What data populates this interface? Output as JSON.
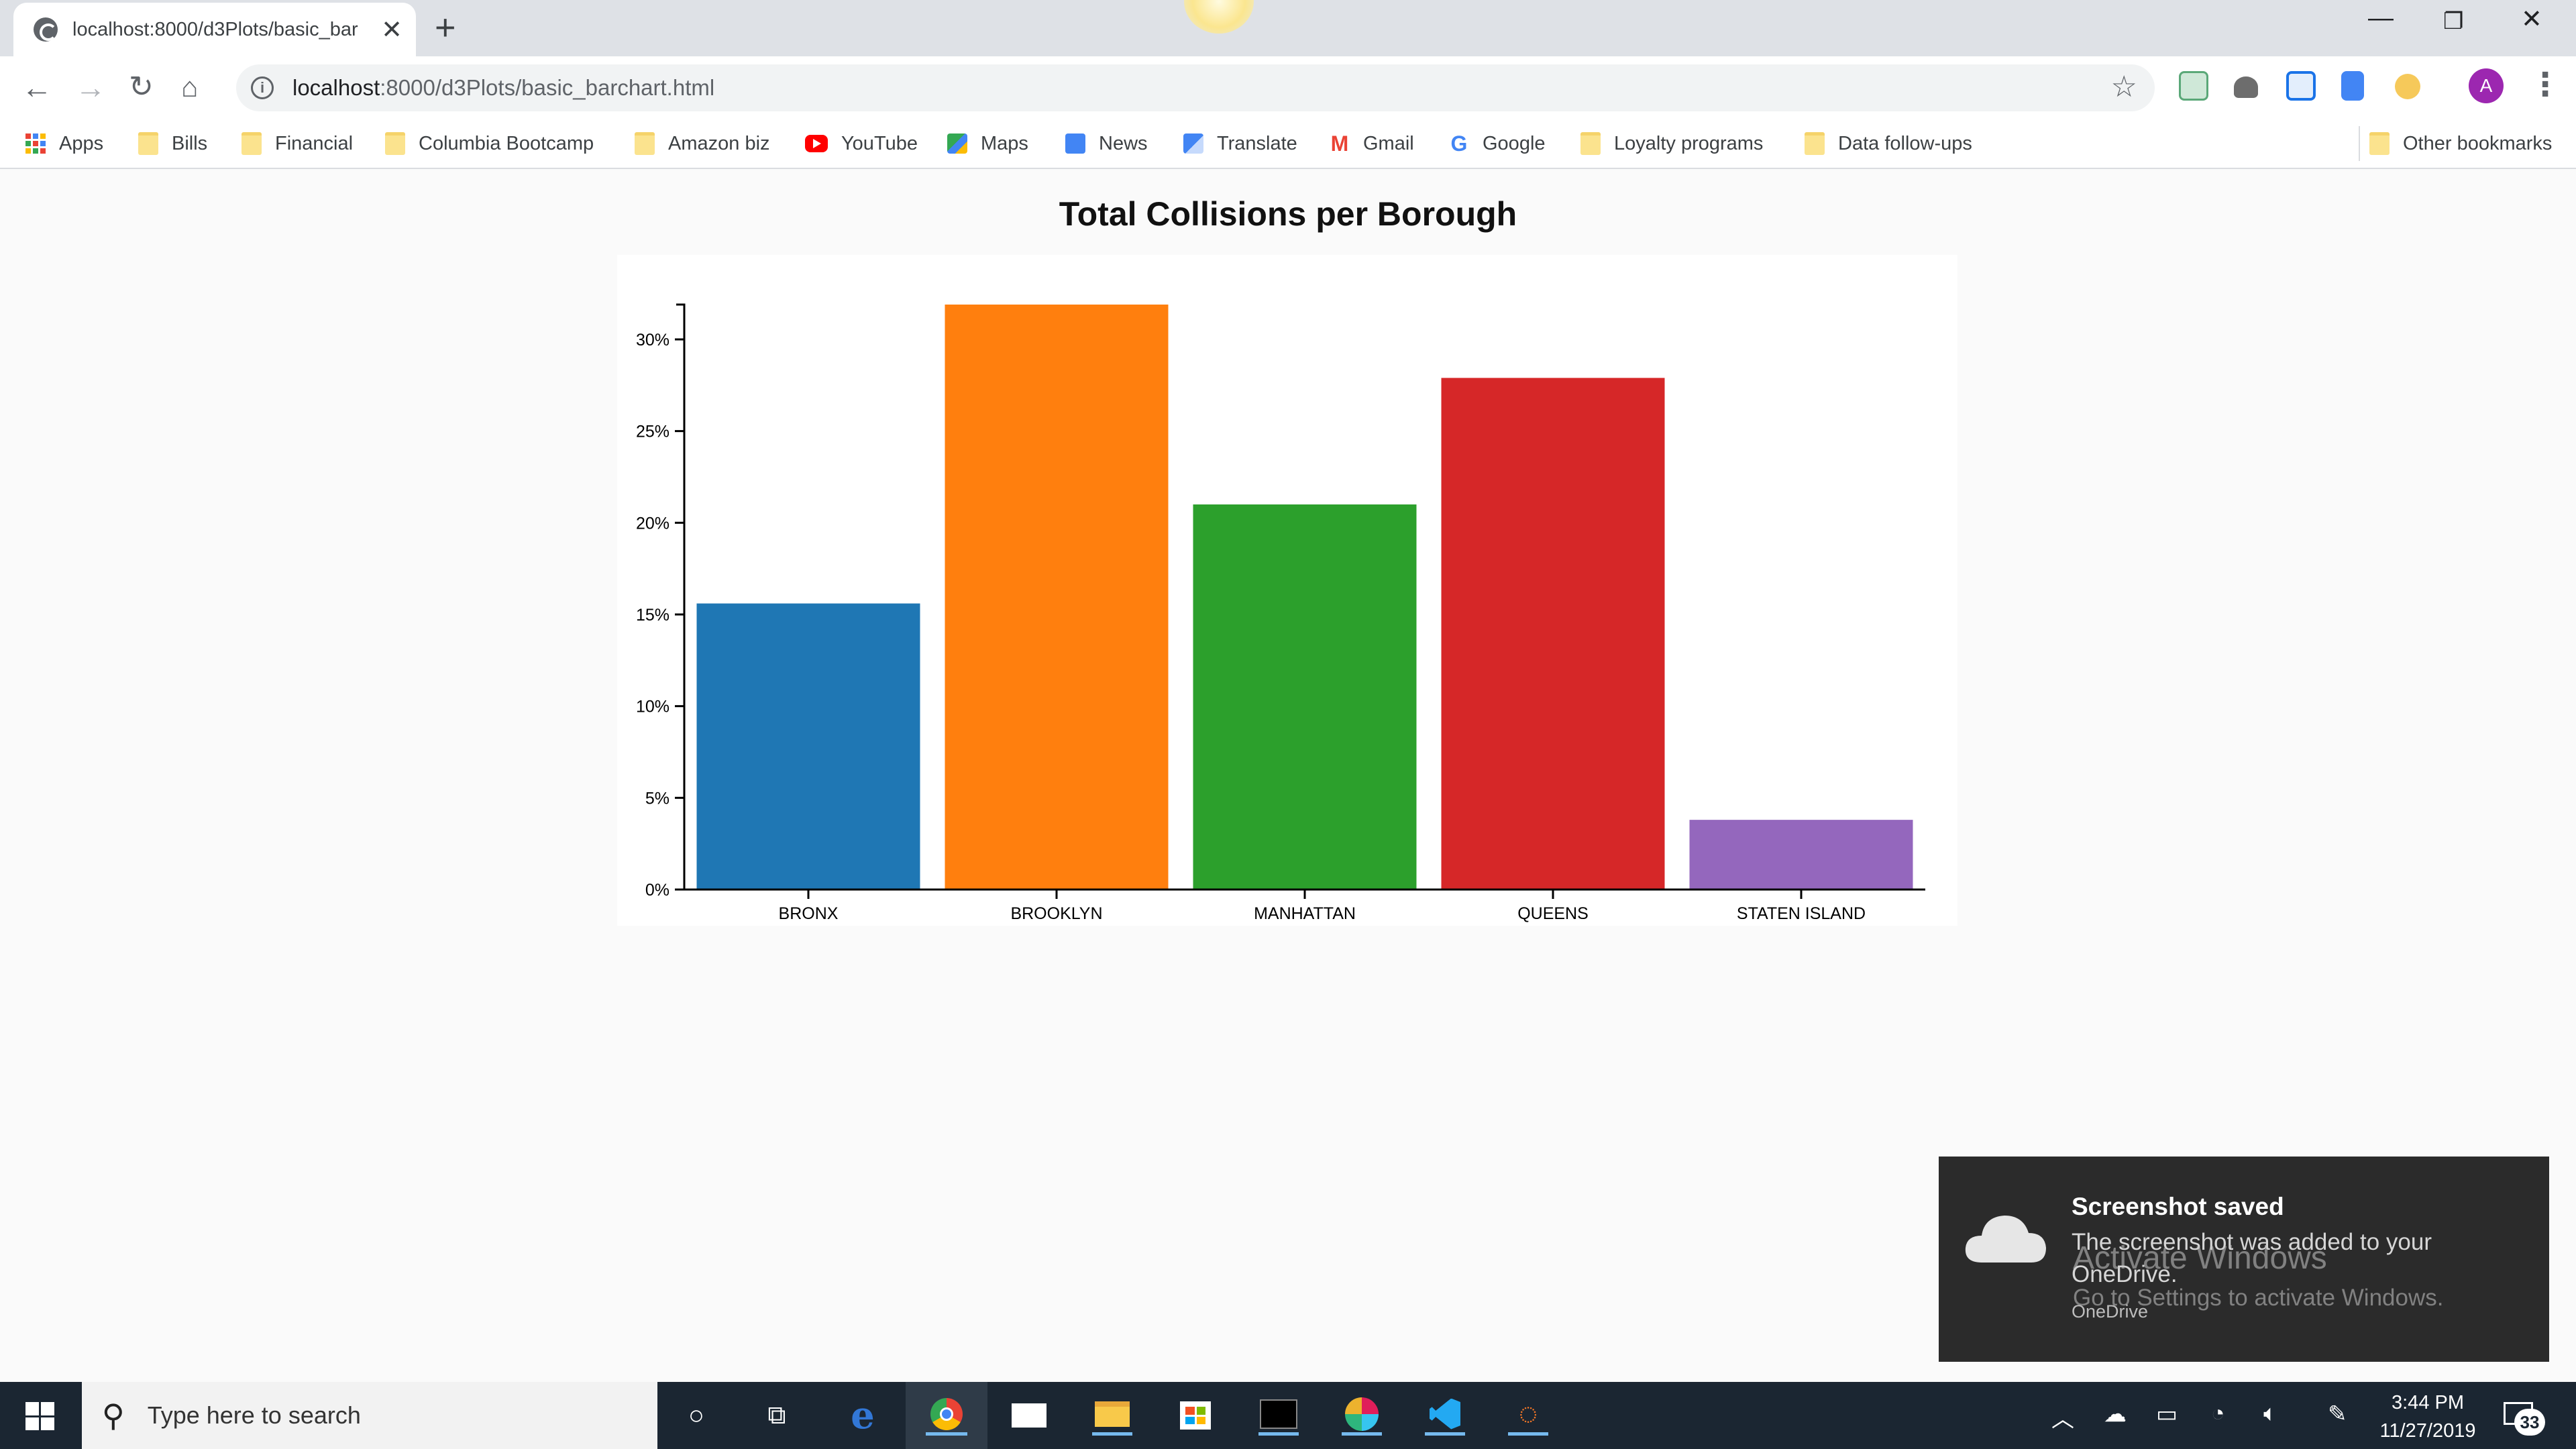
{
  "browser": {
    "tab_title": "localhost:8000/d3Plots/basic_bar",
    "url_host": "localhost",
    "url_path": ":8000/d3Plots/basic_barchart.html",
    "profile_initial": "A"
  },
  "bookmarks": [
    {
      "label": "Apps",
      "icon": "apps-grid-icon"
    },
    {
      "label": "Bills",
      "icon": "folder-icon"
    },
    {
      "label": "Financial",
      "icon": "folder-icon"
    },
    {
      "label": "Columbia Bootcamp",
      "icon": "folder-icon"
    },
    {
      "label": "Amazon biz",
      "icon": "folder-icon"
    },
    {
      "label": "YouTube",
      "icon": "youtube-icon"
    },
    {
      "label": "Maps",
      "icon": "maps-icon"
    },
    {
      "label": "News",
      "icon": "news-icon"
    },
    {
      "label": "Translate",
      "icon": "translate-icon"
    },
    {
      "label": "Gmail",
      "icon": "gmail-icon"
    },
    {
      "label": "Google",
      "icon": "google-icon"
    },
    {
      "label": "Loyalty programs",
      "icon": "folder-icon"
    },
    {
      "label": "Data follow-ups",
      "icon": "folder-icon"
    },
    {
      "label": "Other bookmarks",
      "icon": "folder-icon"
    }
  ],
  "page": {
    "title": "Total Collisions per Borough"
  },
  "chart_data": {
    "type": "bar",
    "title": "Total Collisions per Borough",
    "xlabel": "",
    "ylabel": "",
    "categories": [
      "BRONX",
      "BROOKLYN",
      "MANHATTAN",
      "QUEENS",
      "STATEN ISLAND"
    ],
    "values": [
      15.6,
      31.9,
      21.0,
      27.9,
      3.8
    ],
    "colors": [
      "#1f77b4",
      "#ff7f0e",
      "#2ca02c",
      "#d62728",
      "#9467bd"
    ],
    "ylim": [
      0,
      31.9
    ],
    "yticks": [
      0,
      5,
      10,
      15,
      20,
      25,
      30
    ],
    "ytick_format": "percent",
    "grid": false,
    "legend": "none"
  },
  "toast": {
    "title": "Screenshot saved",
    "body": "The screenshot was added to your OneDrive.",
    "source": "OneDrive"
  },
  "watermark": {
    "line1": "Activate Windows",
    "line2": "Go to Settings to activate Windows."
  },
  "taskbar": {
    "search_placeholder": "Type here to search",
    "time": "3:44 PM",
    "date": "11/27/2019",
    "notification_count": "33"
  }
}
